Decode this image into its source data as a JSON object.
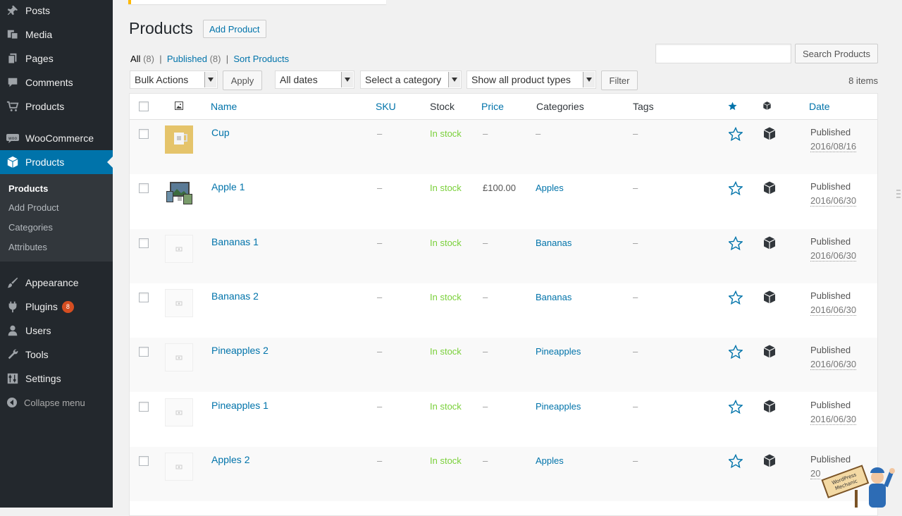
{
  "sidebar": {
    "items": [
      {
        "label": "Posts",
        "icon": "pin-icon"
      },
      {
        "label": "Media",
        "icon": "media-icon"
      },
      {
        "label": "Pages",
        "icon": "pages-icon"
      },
      {
        "label": "Comments",
        "icon": "comments-icon"
      },
      {
        "label": "Products",
        "icon": "cart-icon"
      },
      {
        "label": "WooCommerce",
        "icon": "woo-icon"
      },
      {
        "label": "Products",
        "icon": "cube-icon"
      },
      {
        "label": "Appearance",
        "icon": "brush-icon"
      },
      {
        "label": "Plugins",
        "icon": "plug-icon",
        "badge": "8"
      },
      {
        "label": "Users",
        "icon": "user-icon"
      },
      {
        "label": "Tools",
        "icon": "wrench-icon"
      },
      {
        "label": "Settings",
        "icon": "settings-icon"
      }
    ],
    "submenu": [
      "Products",
      "Add Product",
      "Categories",
      "Attributes"
    ],
    "collapse_label": "Collapse menu"
  },
  "header": {
    "title": "Products",
    "add_button": "Add Product"
  },
  "views": {
    "all_label": "All",
    "all_count": "(8)",
    "published_label": "Published",
    "published_count": "(8)",
    "sort_label": "Sort Products",
    "sep": "|"
  },
  "search": {
    "value": "",
    "button": "Search Products"
  },
  "filters": {
    "bulk_actions": "Bulk Actions",
    "apply": "Apply",
    "dates": "All dates",
    "category": "Select a category",
    "product_types": "Show all product types",
    "filter": "Filter",
    "items_count": "8 items"
  },
  "table": {
    "columns": {
      "name": "Name",
      "sku": "SKU",
      "stock": "Stock",
      "price": "Price",
      "categories": "Categories",
      "tags": "Tags",
      "date": "Date"
    },
    "rows": [
      {
        "name": "Cup",
        "sku": "–",
        "stock": "In stock",
        "price": "–",
        "categories": "–",
        "tags": "–",
        "status": "Published",
        "date": "2016/08/16",
        "thumb": "cup"
      },
      {
        "name": "Apple 1",
        "sku": "–",
        "stock": "In stock",
        "price": "£100.00",
        "categories": "Apples",
        "tags": "–",
        "status": "Published",
        "date": "2016/06/30",
        "thumb": "devices"
      },
      {
        "name": "Bananas 1",
        "sku": "–",
        "stock": "In stock",
        "price": "–",
        "categories": "Bananas",
        "tags": "–",
        "status": "Published",
        "date": "2016/06/30",
        "thumb": "placeholder"
      },
      {
        "name": "Bananas 2",
        "sku": "–",
        "stock": "In stock",
        "price": "–",
        "categories": "Bananas",
        "tags": "–",
        "status": "Published",
        "date": "2016/06/30",
        "thumb": "placeholder"
      },
      {
        "name": "Pineapples 2",
        "sku": "–",
        "stock": "In stock",
        "price": "–",
        "categories": "Pineapples",
        "tags": "–",
        "status": "Published",
        "date": "2016/06/30",
        "thumb": "placeholder"
      },
      {
        "name": "Pineapples 1",
        "sku": "–",
        "stock": "In stock",
        "price": "–",
        "categories": "Pineapples",
        "tags": "–",
        "status": "Published",
        "date": "2016/06/30",
        "thumb": "placeholder"
      },
      {
        "name": "Apples 2",
        "sku": "–",
        "stock": "In stock",
        "price": "–",
        "categories": "Apples",
        "tags": "–",
        "status": "Published",
        "date": "20",
        "thumb": "placeholder"
      }
    ]
  },
  "mascot": {
    "text": "WordPress Mechanic"
  },
  "colors": {
    "accent": "#0073aa",
    "sidebar": "#23282d",
    "in_stock": "#7ad03a",
    "badge": "#d54e21"
  }
}
